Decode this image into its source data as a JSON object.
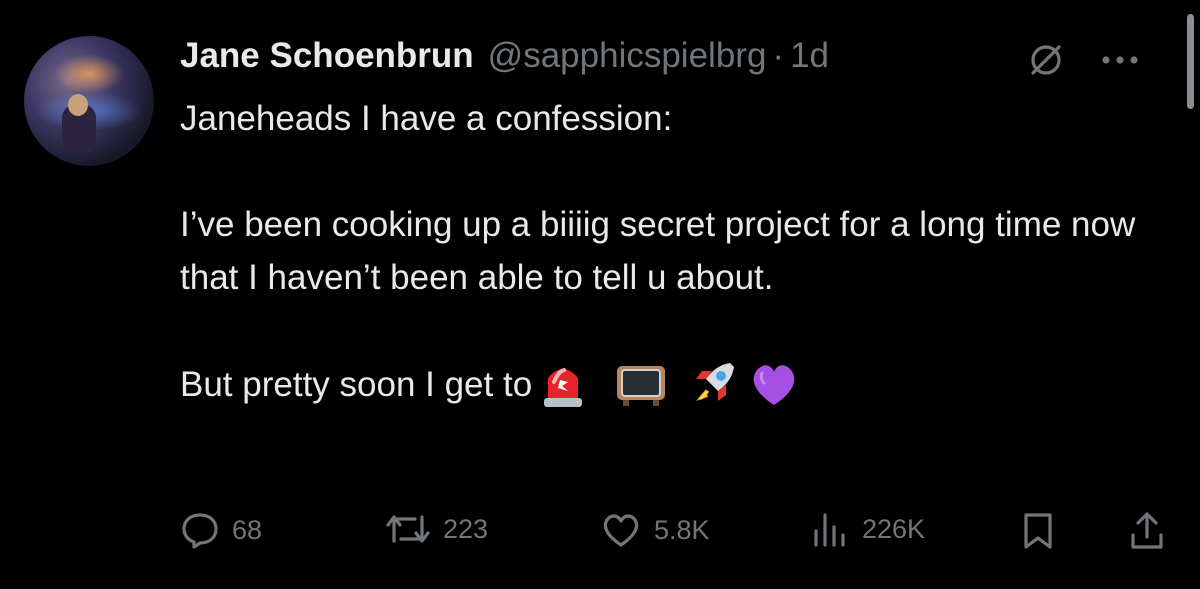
{
  "author": {
    "display_name": "Jane Schoenbrun",
    "handle": "@sapphicspielbrg",
    "separator": "·",
    "timestamp": "1d"
  },
  "tweet": {
    "line1": "Janeheads I have a confession:",
    "paragraph2": "I’ve been cooking up a biiiig secret project for a long time now that I haven’t been able to tell u about.",
    "line3_text": "But pretty soon I get to",
    "emojis": [
      "police-light-emoji",
      "television-emoji",
      "rocket-emoji",
      "purple-heart-emoji"
    ]
  },
  "actions": {
    "replies": "68",
    "reposts": "223",
    "likes": "5.8K",
    "views": "226K"
  },
  "icons": {
    "reply": "reply-icon",
    "repost": "repost-icon",
    "like": "heart-icon",
    "views": "views-chart-icon",
    "bookmark": "bookmark-icon",
    "share": "share-icon",
    "grok": "grok-icon",
    "more": "more-icon"
  },
  "colors": {
    "background": "#000000",
    "primary_text": "#e7e9ea",
    "secondary_text": "#71767b"
  }
}
